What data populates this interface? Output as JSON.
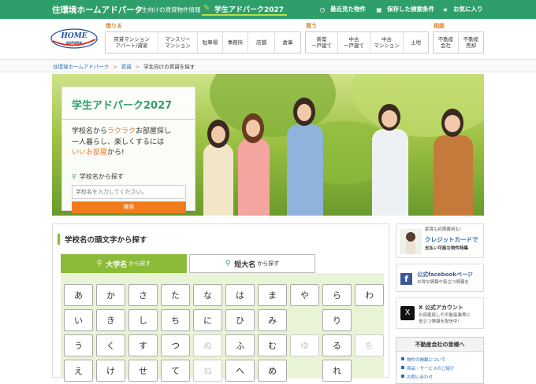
{
  "topbar": {
    "brand": "住環境ホームアドパーク",
    "subtitle": "学生向けの賃貸物件情報",
    "campaign": "学生アドパーク2027",
    "links": [
      {
        "label": "最近見た物件",
        "icon": "clock-icon"
      },
      {
        "label": "保存した検索条件",
        "icon": "save-icon"
      },
      {
        "label": "お気に入り",
        "icon": "star-icon"
      }
    ]
  },
  "logo": {
    "line1": "HOME",
    "line2": "ADPARK"
  },
  "nav": {
    "rent_label": "借りる",
    "buy_label": "買う",
    "sell_label": "相談",
    "rent_items": [
      "賃貸マンション\nアパート/貸家",
      "マンスリー\nマンション",
      "駐車場",
      "事務所",
      "店舗",
      "倉庫"
    ],
    "buy_items": [
      "新築\n一戸建て",
      "中古\n一戸建て",
      "中古\nマンション",
      "土地"
    ],
    "sell_items": [
      "不動産\n会社",
      "不動産\n売却"
    ]
  },
  "breadcrumb": {
    "home": "住環境ホームアドパーク",
    "rent": "賃貸",
    "current": "学生向けの賃貸を探す"
  },
  "hero": {
    "title": "学生アドパーク2027",
    "copy_line1_pre": "学校名から",
    "copy_line1_hl": "ラクラク",
    "copy_line1_post": "お部屋探し",
    "copy_line2": "一人暮らし、楽しくするには",
    "copy_line3_hl": "いいお部屋",
    "copy_line3_post": "から!",
    "search_label": "学校名から探す",
    "search_placeholder": "学校名を入力してください。",
    "search_button": "検索"
  },
  "main": {
    "heading": "学校名の頭文字から探す",
    "tab_univ": "大学名",
    "tab_junior": "短大名",
    "tab_suffix": "から探す",
    "kana_rows": [
      [
        "あ",
        "か",
        "さ",
        "た",
        "な",
        "は",
        "ま",
        "や",
        "ら",
        "わ"
      ],
      [
        "い",
        "き",
        "し",
        "ち",
        "に",
        "ひ",
        "み",
        "",
        "り",
        ""
      ],
      [
        "う",
        "く",
        "す",
        "つ",
        "ぬ",
        "ふ",
        "む",
        "ゆ",
        "る",
        "を"
      ],
      [
        "え",
        "け",
        "せ",
        "て",
        "ね",
        "へ",
        "め",
        "",
        "れ",
        ""
      ]
    ],
    "disabled_kana": [
      "ぬ",
      "ゆ",
      "を",
      "ね"
    ]
  },
  "sidebar": {
    "credit_title_pre": "家賃も初期費用も!",
    "credit_title": "クレジットカードで",
    "credit_sub": "支払い可能な物件特集",
    "fb_title": "公式facebookページ",
    "fb_sub": "お得な情報や役立つ情報を",
    "x_title": "X 公式アカウント",
    "x_sub1": "お部屋探しや不動産業界に",
    "x_sub2": "役立つ情報を配信中!",
    "agents_head": "不動産会社の皆様へ",
    "agents_items": [
      "物件の掲載について",
      "商品・サービスのご紹介",
      "お問い合わせ"
    ]
  },
  "colors": {
    "brand_green": "#2e9e6a",
    "accent_orange": "#f07b1d",
    "tab_green": "#8cbb3a"
  }
}
